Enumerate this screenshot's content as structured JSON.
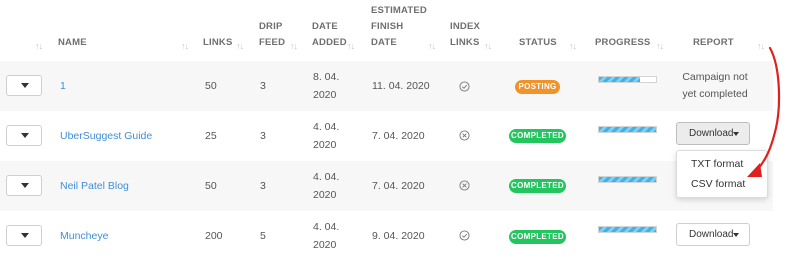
{
  "columns": {
    "name": "NAME",
    "links": "LINKS",
    "drip_feed_1": "DRIP",
    "drip_feed_2": "FEED",
    "date_added_1": "DATE",
    "date_added_2": "ADDED",
    "est_finish_1": "ESTIMATED",
    "est_finish_2": "FINISH",
    "est_finish_3": "DATE",
    "index_links_1": "INDEX",
    "index_links_2": "LINKS",
    "status": "STATUS",
    "progress": "PROGRESS",
    "report": "REPORT"
  },
  "sort_icon": "↑↓",
  "rows": [
    {
      "name": "1",
      "links": "50",
      "drip_feed": "3",
      "date_added_1": "8. 04.",
      "date_added_2": "2020",
      "est_finish": "11. 04. 2020",
      "index_icon": "check-circle-icon",
      "status": "POSTING",
      "progress": 0.4,
      "report_1": "Campaign not",
      "report_2": "yet completed"
    },
    {
      "name": "UberSuggest Guide",
      "links": "25",
      "drip_feed": "3",
      "date_added_1": "4. 04.",
      "date_added_2": "2020",
      "est_finish": "7. 04. 2020",
      "index_icon": "x-circle-icon",
      "status": "COMPLETED",
      "progress": 1.0,
      "report_button": "Download"
    },
    {
      "name": "Neil Patel Blog",
      "links": "50",
      "drip_feed": "3",
      "date_added_1": "4. 04.",
      "date_added_2": "2020",
      "est_finish": "7. 04. 2020",
      "index_icon": "x-circle-icon",
      "status": "COMPLETED",
      "progress": 1.0
    },
    {
      "name": "Muncheye",
      "links": "200",
      "drip_feed": "5",
      "date_added_1": "4. 04.",
      "date_added_2": "2020",
      "est_finish": "9. 04. 2020",
      "index_icon": "check-circle-icon",
      "status": "COMPLETED",
      "progress": 1.0,
      "report_button": "Download"
    }
  ],
  "dropdown": {
    "options": [
      "TXT format",
      "CSV format"
    ]
  },
  "colors": {
    "posting": "#f0932b",
    "completed": "#22c55e",
    "link": "#3f8fd9",
    "arrow": "#e0201e"
  }
}
